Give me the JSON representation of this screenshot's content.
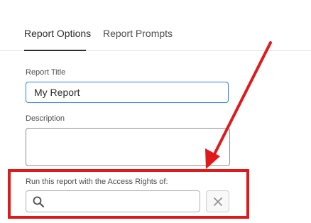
{
  "tabs": [
    {
      "label": "Report Options",
      "active": true
    },
    {
      "label": "Report Prompts",
      "active": false
    }
  ],
  "form": {
    "title_label": "Report Title",
    "title_value": "My Report",
    "description_label": "Description",
    "description_value": "",
    "access_rights_label": "Run this report with the Access Rights of:",
    "access_rights_value": ""
  },
  "icons": {
    "search": "search-icon",
    "clear": "close-icon"
  },
  "colors": {
    "accent_blue": "#2680eb",
    "annotation_red": "#e01a1a",
    "text": "#2c2c2c"
  }
}
